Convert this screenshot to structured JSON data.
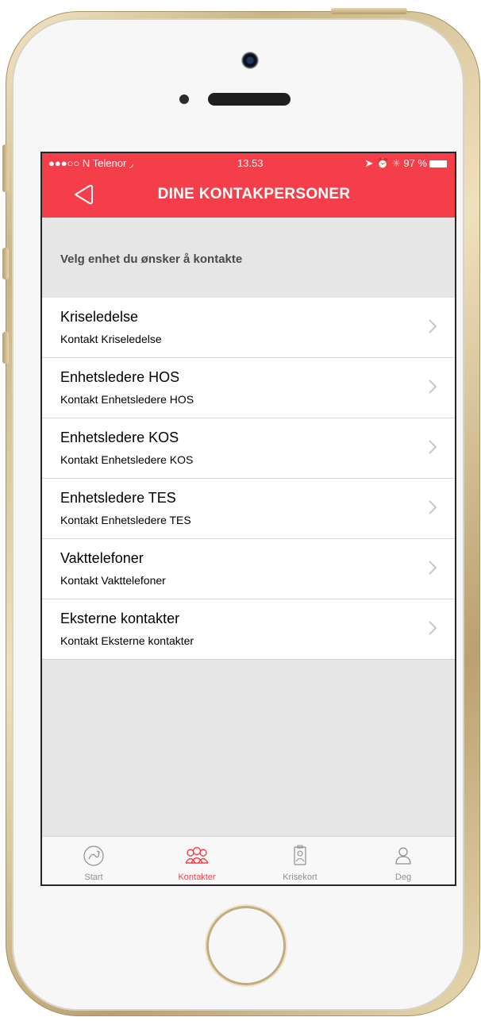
{
  "status_bar": {
    "carrier": "●●●○○ N Telenor",
    "time": "13.53",
    "battery": "97 %"
  },
  "nav": {
    "title": "DINE KONTAKPERSONER"
  },
  "section": {
    "header": "Velg enhet du ønsker å kontakte"
  },
  "contacts": [
    {
      "title": "Kriseledelse",
      "subtitle": "Kontakt Kriseledelse"
    },
    {
      "title": "Enhetsledere HOS",
      "subtitle": "Kontakt Enhetsledere HOS"
    },
    {
      "title": "Enhetsledere KOS",
      "subtitle": "Kontakt Enhetsledere KOS"
    },
    {
      "title": "Enhetsledere TES",
      "subtitle": "Kontakt Enhetsledere TES"
    },
    {
      "title": "Vakttelefoner",
      "subtitle": "Kontakt Vakttelefoner"
    },
    {
      "title": "Eksterne kontakter",
      "subtitle": "Kontakt Eksterne kontakter"
    }
  ],
  "tabs": [
    {
      "label": "Start",
      "icon": "start-icon",
      "active": false
    },
    {
      "label": "Kontakter",
      "icon": "contacts-icon",
      "active": true
    },
    {
      "label": "Krisekort",
      "icon": "crisis-card-icon",
      "active": false
    },
    {
      "label": "Deg",
      "icon": "profile-icon",
      "active": false
    }
  ],
  "colors": {
    "accent": "#f43f4a",
    "inactive_tab": "#8f8f8f",
    "background": "#e6e6e6"
  }
}
